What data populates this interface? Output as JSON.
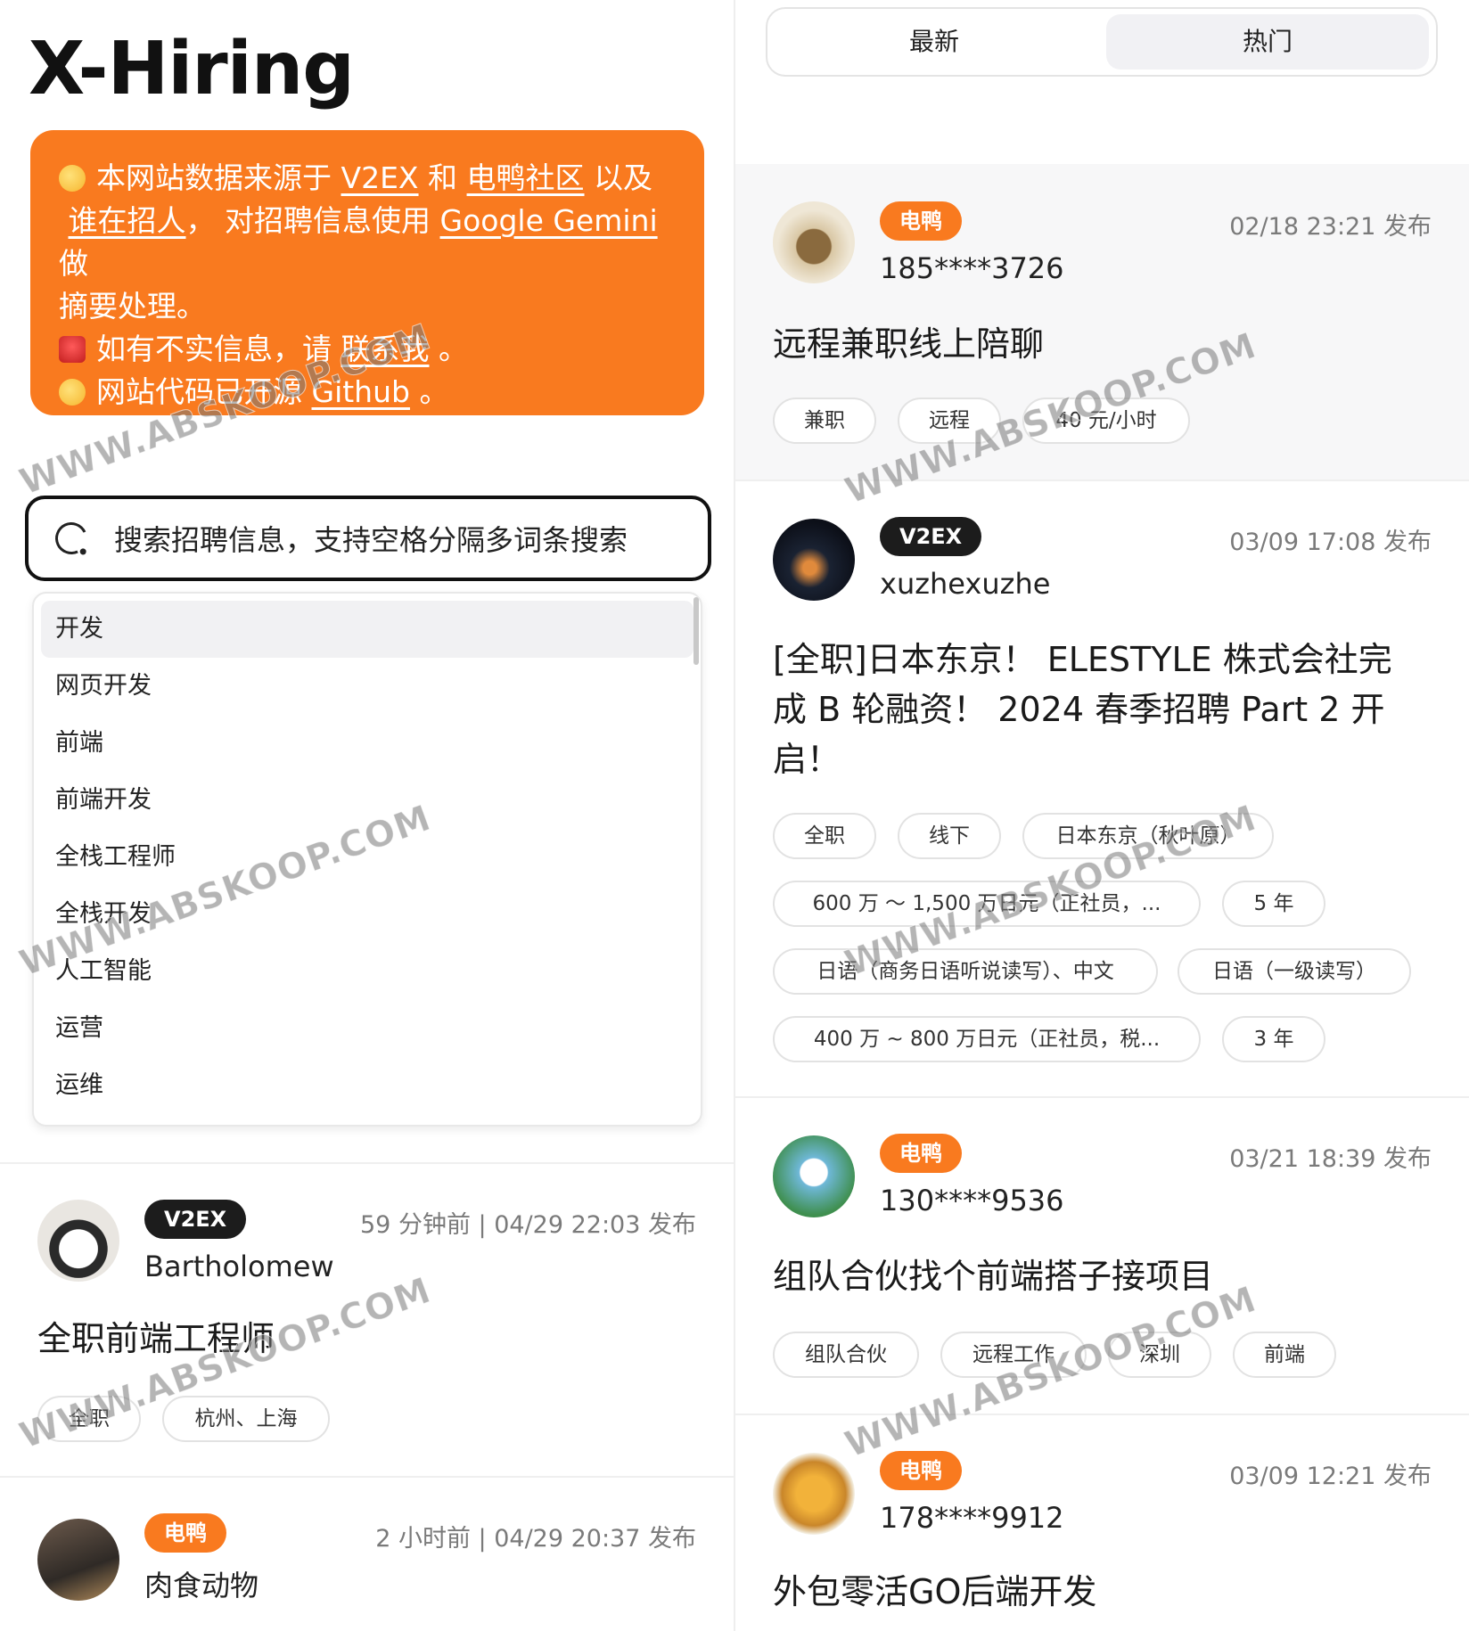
{
  "app": {
    "title": "X-Hiring"
  },
  "notice": {
    "l1_pre": "本网站数据来源于",
    "l1_link1": "V2EX",
    "l1_mid": "和",
    "l1_link2": "电鸭社区",
    "l1_post": "以及",
    "l2_link": "谁在招人",
    "l2_mid": "， 对招聘信息使用",
    "l2_link2": "Google Gemini",
    "l2_post": "做",
    "l3": "摘要处理。",
    "l4_pre": "如有不实信息，请",
    "l4_link": "联系我",
    "l4_post": "。",
    "l5_pre": "网站代码已开源",
    "l5_link": "Github",
    "l5_post": "。",
    "emoji_1": "smiling-face-icon",
    "emoji_2": "siren-icon",
    "emoji_3": "hugging-face-icon"
  },
  "search": {
    "placeholder": "搜索招聘信息，支持空格分隔多词条搜索"
  },
  "suggestions": [
    "开发",
    "网页开发",
    "前端",
    "前端开发",
    "全栈工程师",
    "全栈开发",
    "人工智能",
    "运营",
    "运维"
  ],
  "tabs": {
    "latest": "最新",
    "hot": "热门",
    "active": "热门"
  },
  "left_posts": [
    {
      "source": "V2EX",
      "author": "Bartholomew",
      "time": "59 分钟前 | 04/29 22:03 发布",
      "title": "全职前端工程师",
      "tags": [
        "全职",
        "杭州、上海"
      ]
    },
    {
      "source": "电鸭",
      "author": "肉食动物",
      "time": "2 小时前 | 04/29 20:37 发布"
    }
  ],
  "right_posts": [
    {
      "source": "电鸭",
      "author": "185****3726",
      "time": "02/18 23:21 发布",
      "title": "远程兼职线上陪聊",
      "tags": [
        "兼职",
        "远程",
        "40 元/小时"
      ]
    },
    {
      "source": "V2EX",
      "author": "xuzhexuzhe",
      "time": "03/09 17:08 发布",
      "title_l1": "[全职]日本东京！ ELESTYLE 株式会社完",
      "title_l2": "成 B 轮融资！ 2024 春季招聘 Part 2 开",
      "title_l3": "启！",
      "tags": [
        "全职",
        "线下",
        "日本东京（秋叶原）",
        "600 万 ～ 1,500 万日元（正社员，...",
        "5 年",
        "日语（商务日语听说读写）、中文",
        "日语（一级读写）",
        "400 万 ~ 800 万日元（正社员，税...",
        "3 年"
      ]
    },
    {
      "source": "电鸭",
      "author": "130****9536",
      "time": "03/21 18:39 发布",
      "title": "组队合伙找个前端搭子接项目",
      "tags": [
        "组队合伙",
        "远程工作",
        "深圳",
        "前端"
      ]
    },
    {
      "source": "电鸭",
      "author": "178****9912",
      "time": "03/09 12:21 发布",
      "title": "外包零活GO后端开发"
    }
  ],
  "watermark": "WWW.ABSKOOP.COM",
  "colors": {
    "accent": "#f97a1f",
    "v2ex_badge": "#1c1c1c"
  }
}
